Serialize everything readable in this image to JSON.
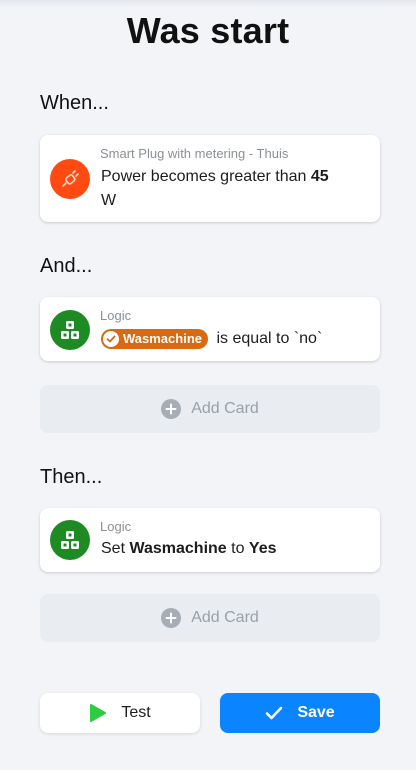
{
  "page": {
    "title": "Was start"
  },
  "when": {
    "label": "When...",
    "card": {
      "owner": "Smart Plug with metering - Thuis",
      "text_prefix": "Power becomes greater than ",
      "value": "45",
      "unit": "W",
      "icon": "plug-icon",
      "icon_color": "#ff4b12"
    }
  },
  "and": {
    "label": "And...",
    "card": {
      "owner": "Logic",
      "tag": "Wasmachine",
      "text_suffix": " is equal to `no`",
      "icon": "logic-icon",
      "icon_color": "#1e8a23",
      "tag_color": "#d86b12"
    },
    "add_card_label": "Add Card"
  },
  "then": {
    "label": "Then...",
    "card": {
      "owner": "Logic",
      "text_set": "Set ",
      "variable": "Wasmachine",
      "text_to": " to ",
      "value": "Yes",
      "icon": "logic-icon",
      "icon_color": "#1e8a23"
    },
    "add_card_label": "Add Card"
  },
  "footer": {
    "test_label": "Test",
    "save_label": "Save",
    "save_color": "#0a84ff",
    "test_icon_color": "#2ecc40"
  }
}
